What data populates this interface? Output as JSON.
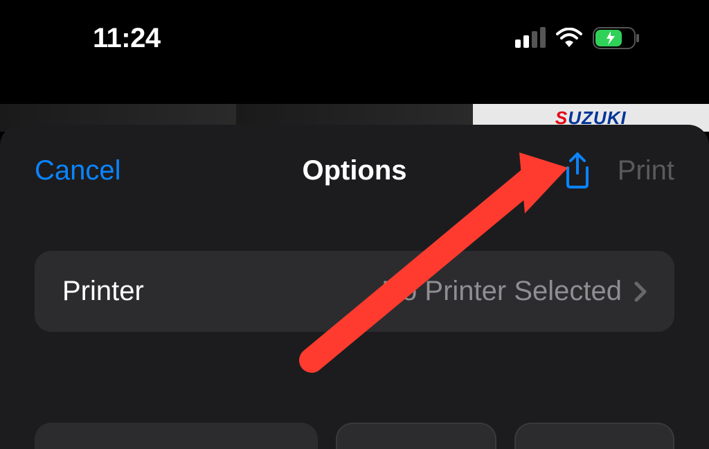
{
  "status_bar": {
    "time": "11:24"
  },
  "backdrop": {
    "brand_prefix": "S",
    "brand_rest": "UZUKI"
  },
  "sheet": {
    "cancel_label": "Cancel",
    "title": "Options",
    "print_label": "Print"
  },
  "printer_row": {
    "label": "Printer",
    "value": "No Printer Selected"
  },
  "colors": {
    "accent": "#0a84ff",
    "disabled": "#5a5a5c",
    "secondary_text": "#8e8e93"
  }
}
